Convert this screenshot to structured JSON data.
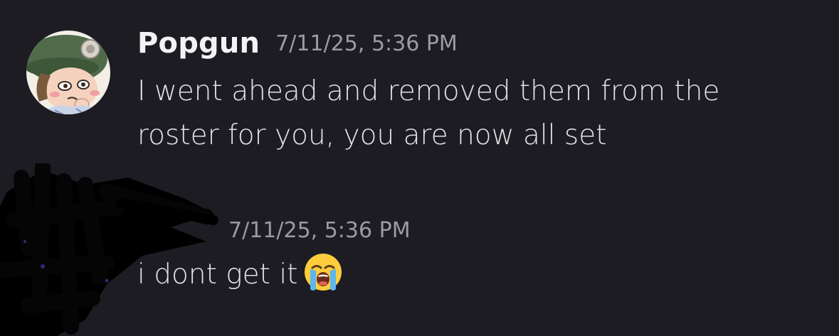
{
  "messages": [
    {
      "author": "Popgun",
      "timestamp": "7/11/25, 5:36 PM",
      "text_line1": "I went ahead and removed them from the",
      "text_line2": "roster for you, you are now all set",
      "avatar_icon": "avatar-green-beret-character"
    },
    {
      "author": "",
      "timestamp": "7/11/25, 5:36 PM",
      "text": "i dont get it",
      "emoji": "loudly-crying-face-emoji",
      "redacted": true
    }
  ],
  "colors": {
    "background": "#1c1c22",
    "username": "#f2f3f5",
    "timestamp": "#9a9ca3",
    "message_text": "#e1e3e6"
  }
}
